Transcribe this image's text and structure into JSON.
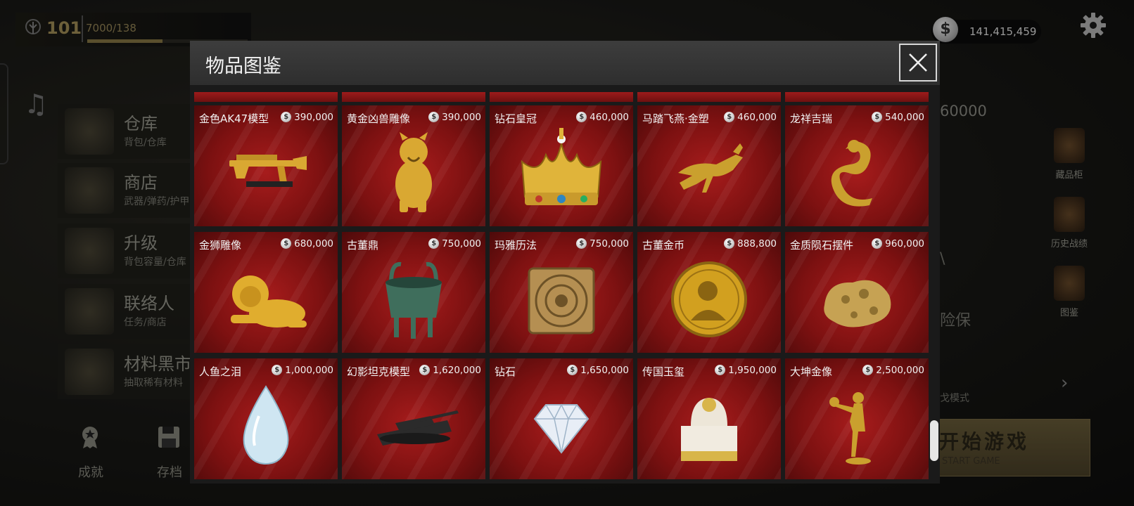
{
  "player": {
    "level": "101",
    "xp_text": "7000/138",
    "xp_progress": 0.47
  },
  "currency": {
    "amount": "141,415,459",
    "symbol": "$"
  },
  "left_menu": [
    {
      "title": "仓库",
      "subtitle": "背包/仓库"
    },
    {
      "title": "商店",
      "subtitle": "武器/弹药/护甲"
    },
    {
      "title": "升级",
      "subtitle": "背包容量/仓库"
    },
    {
      "title": "联络人",
      "subtitle": "任务/商店"
    },
    {
      "title": "材料黑市",
      "subtitle": "抽取稀有材料"
    }
  ],
  "bottom_nav": [
    {
      "label": "成就",
      "icon": "medal-icon"
    },
    {
      "label": "存档",
      "icon": "save-icon"
    }
  ],
  "right_panel": {
    "stat_fragment": "60000",
    "items": [
      {
        "label": "藏品柜",
        "icon": "cabinet-icon"
      },
      {
        "label": "历史战绩",
        "icon": "scroll-icon"
      },
      {
        "label": "图鉴",
        "icon": "book-icon"
      }
    ],
    "text_fragments": [
      "\\",
      "险保",
      "戈模式"
    ],
    "start_button": {
      "label": "开始游戏",
      "sub": "START GAME"
    }
  },
  "modal": {
    "title": "物品图鉴",
    "items": [
      {
        "name": "金色AK47模型",
        "price": "390,000",
        "art": "gold-ak47"
      },
      {
        "name": "黄金凶兽雕像",
        "price": "390,000",
        "art": "gold-beast"
      },
      {
        "name": "钻石皇冠",
        "price": "460,000",
        "art": "crown"
      },
      {
        "name": "马踏飞燕·金塑",
        "price": "460,000",
        "art": "gold-horse"
      },
      {
        "name": "龙祥吉瑞",
        "price": "540,000",
        "art": "gold-dragon"
      },
      {
        "name": "金狮雕像",
        "price": "680,000",
        "art": "gold-lion"
      },
      {
        "name": "古董鼎",
        "price": "750,000",
        "art": "bronze-ding"
      },
      {
        "name": "玛雅历法",
        "price": "750,000",
        "art": "maya-calendar"
      },
      {
        "name": "古董金币",
        "price": "888,800",
        "art": "gold-coin"
      },
      {
        "name": "金质陨石摆件",
        "price": "960,000",
        "art": "gold-meteorite"
      },
      {
        "name": "人鱼之泪",
        "price": "1,000,000",
        "art": "teardrop"
      },
      {
        "name": "幻影坦克模型",
        "price": "1,620,000",
        "art": "tank"
      },
      {
        "name": "钻石",
        "price": "1,650,000",
        "art": "diamond"
      },
      {
        "name": "传国玉玺",
        "price": "1,950,000",
        "art": "jade-seal"
      },
      {
        "name": "大坤金像",
        "price": "2,500,000",
        "art": "gold-statue"
      }
    ]
  },
  "colors": {
    "card_red": "#8a1414",
    "gold": "#d4a72c",
    "panel": "#1a1a1a"
  }
}
